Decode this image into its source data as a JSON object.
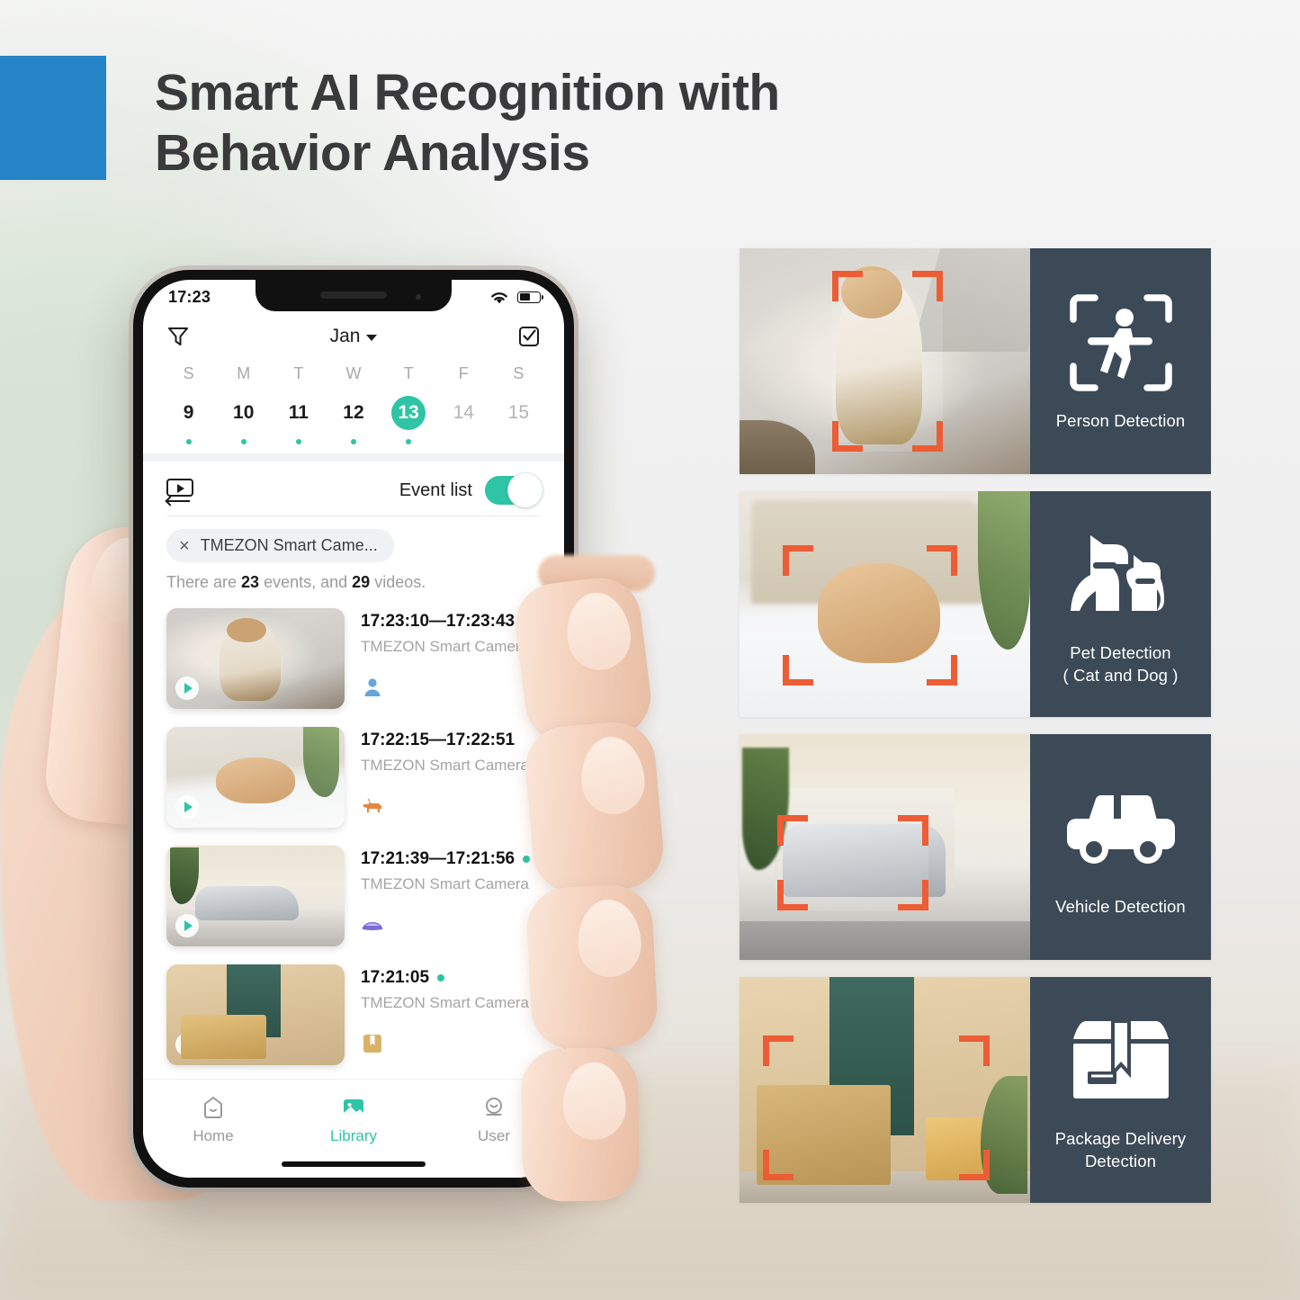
{
  "colors": {
    "brand_blue": "#2484c6",
    "teal": "#2ec4a5",
    "slate": "#3c4a57",
    "bracket_orange": "#ec5d35"
  },
  "header": {
    "title_line1": "Smart AI Recognition with",
    "title_line2": "Behavior Analysis"
  },
  "phone": {
    "status": {
      "time": "17:23",
      "wifi_icon": "wifi-icon",
      "battery_icon": "battery-icon"
    },
    "app_bar": {
      "filter_icon": "filter-icon",
      "month": "Jan",
      "select_icon": "checkbox-select-icon"
    },
    "calendar": {
      "dow": [
        "S",
        "M",
        "T",
        "W",
        "T",
        "F",
        "S"
      ],
      "days": [
        {
          "num": "9",
          "selected": false,
          "dim": false,
          "dot": true
        },
        {
          "num": "10",
          "selected": false,
          "dim": false,
          "dot": true
        },
        {
          "num": "11",
          "selected": false,
          "dim": false,
          "dot": true
        },
        {
          "num": "12",
          "selected": false,
          "dim": false,
          "dot": true
        },
        {
          "num": "13",
          "selected": true,
          "dim": false,
          "dot": true
        },
        {
          "num": "14",
          "selected": false,
          "dim": true,
          "dot": false
        },
        {
          "num": "15",
          "selected": false,
          "dim": true,
          "dot": false
        }
      ]
    },
    "event_toggle": {
      "playback_icon": "video-playback-icon",
      "label": "Event list",
      "state": "on"
    },
    "filter_chip": {
      "close": "×",
      "label": "TMEZON Smart Came..."
    },
    "summary": {
      "prefix": "There are ",
      "events_count": "23",
      "middle": " events, and ",
      "videos_count": "29",
      "suffix": " videos."
    },
    "events": [
      {
        "time": "17:23:10—17:23:43",
        "camera": "TMEZON Smart Camera",
        "badge": "person-badge-icon",
        "scene": "child",
        "unread": true
      },
      {
        "time": "17:22:15—17:22:51",
        "camera": "TMEZON Smart Camera",
        "badge": "pet-badge-icon",
        "scene": "dog",
        "unread": false
      },
      {
        "time": "17:21:39—17:21:56",
        "camera": "TMEZON Smart Camera",
        "badge": "vehicle-badge-icon",
        "scene": "car",
        "unread": true
      },
      {
        "time": "17:21:05",
        "camera": "TMEZON Smart Camera",
        "badge": "package-badge-icon",
        "scene": "package",
        "unread": true
      }
    ],
    "tabs": [
      {
        "label": "Home",
        "icon": "home-icon",
        "active": false
      },
      {
        "label": "Library",
        "icon": "library-image-icon",
        "active": true
      },
      {
        "label": "User",
        "icon": "user-icon",
        "active": false
      }
    ]
  },
  "feature_cards": [
    {
      "caption_line1": "Person Detection",
      "caption_line2": "",
      "icon": "person-detection-icon",
      "scene": "child"
    },
    {
      "caption_line1": "Pet Detection",
      "caption_line2": "( Cat and Dog )",
      "icon": "pet-detection-icon",
      "scene": "dog"
    },
    {
      "caption_line1": "Vehicle Detection",
      "caption_line2": "",
      "icon": "vehicle-detection-icon",
      "scene": "car"
    },
    {
      "caption_line1": "Package Delivery",
      "caption_line2": "Detection",
      "icon": "package-detection-icon",
      "scene": "package"
    }
  ]
}
